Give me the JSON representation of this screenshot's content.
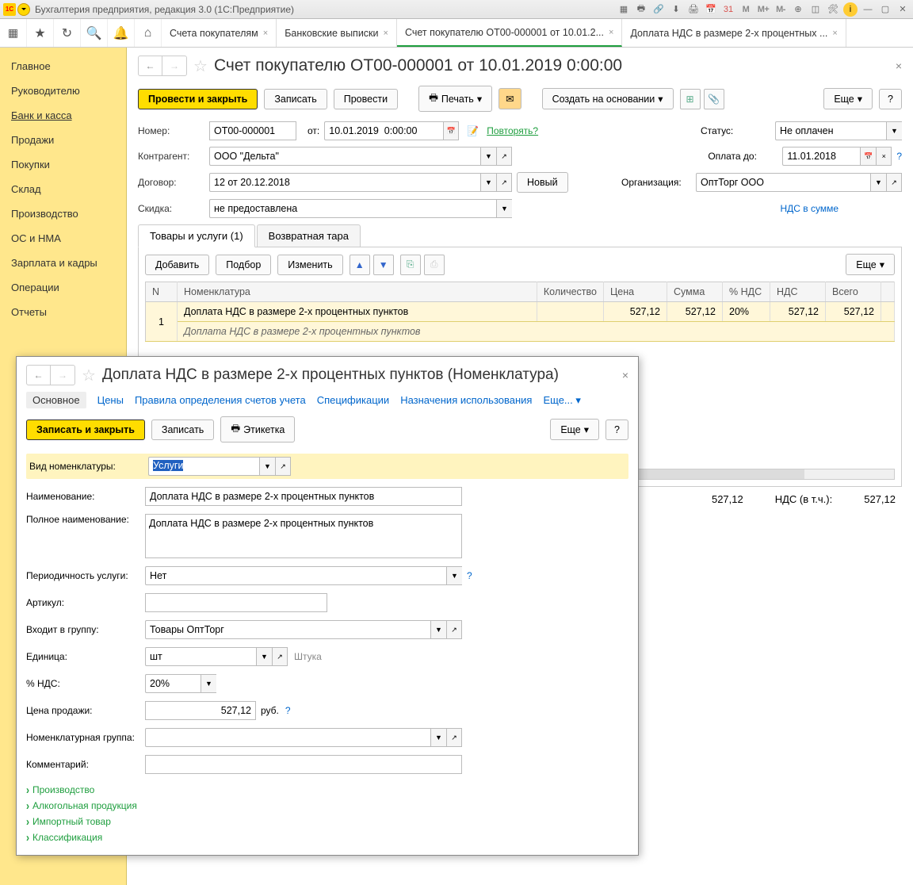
{
  "titlebar": {
    "title": "Бухгалтерия предприятия, редакция 3.0  (1С:Предприятие)"
  },
  "tabs": [
    {
      "label": "Счета покупателям",
      "active": false
    },
    {
      "label": "Банковские выписки",
      "active": false
    },
    {
      "label": "Счет покупателю ОТ00-000001 от 10.01.2...",
      "active": true
    },
    {
      "label": "Доплата НДС в размере 2-х процентных ...",
      "active": false
    }
  ],
  "sidebar": [
    "Главное",
    "Руководителю",
    "Банк и касса",
    "Продажи",
    "Покупки",
    "Склад",
    "Производство",
    "ОС и НМА",
    "Зарплата и кадры",
    "Операции",
    "Отчеты"
  ],
  "sidebar_active": "Банк и касса",
  "page": {
    "title": "Счет покупателю ОТ00-000001 от 10.01.2019 0:00:00",
    "buttons": {
      "commit_close": "Провести и закрыть",
      "write": "Записать",
      "commit": "Провести",
      "print": "Печать",
      "create_based": "Создать на основании",
      "more": "Еще"
    },
    "fields": {
      "number_label": "Номер:",
      "number": "ОТ00-000001",
      "date_label": "от:",
      "date": "10.01.2019  0:00:00",
      "repeat": "Повторять?",
      "status_label": "Статус:",
      "status": "Не оплачен",
      "counterparty_label": "Контрагент:",
      "counterparty": "ООО \"Дельта\"",
      "pay_until_label": "Оплата до:",
      "pay_until": "11.01.2018",
      "contract_label": "Договор:",
      "contract": "12 от 20.12.2018",
      "new_btn": "Новый",
      "org_label": "Организация:",
      "org": "ОптТорг ООО",
      "discount_label": "Скидка:",
      "discount": "не предоставлена",
      "nds_mode": "НДС в сумме"
    },
    "inner_tabs": [
      "Товары и услуги (1)",
      "Возвратная тара"
    ],
    "grid_toolbar": {
      "add": "Добавить",
      "pick": "Подбор",
      "edit": "Изменить",
      "more": "Еще"
    },
    "grid_headers": [
      "N",
      "Номенклатура",
      "Количество",
      "Цена",
      "Сумма",
      "% НДС",
      "НДС",
      "Всего"
    ],
    "grid_row": {
      "n": "1",
      "name": "Доплата НДС в размере 2-х процентных пунктов",
      "name2": "Доплата НДС в размере 2-х процентных пунктов",
      "qty": "",
      "price": "527,12",
      "sum": "527,12",
      "vat_pct": "20%",
      "vat": "527,12",
      "total": "527,12"
    },
    "totals": {
      "sum": "527,12",
      "vat_label": "НДС (в т.ч.):",
      "vat": "527,12"
    }
  },
  "dialog": {
    "title": "Доплата НДС в размере 2-х процентных пунктов (Номенклатура)",
    "tabs": [
      "Основное",
      "Цены",
      "Правила определения счетов учета",
      "Спецификации",
      "Назначения использования",
      "Еще..."
    ],
    "buttons": {
      "save_close": "Записать и закрыть",
      "save": "Записать",
      "label_btn": "Этикетка",
      "more": "Еще"
    },
    "fields": {
      "type_label": "Вид номенклатуры:",
      "type": "Услуги",
      "name_label": "Наименование:",
      "name": "Доплата НДС в размере 2-х процентных пунктов",
      "fullname_label": "Полное наименование:",
      "fullname": "Доплата НДС в размере 2-х процентных пунктов",
      "period_label": "Периодичность услуги:",
      "period": "Нет",
      "sku_label": "Артикул:",
      "sku": "",
      "group_label": "Входит в группу:",
      "group": "Товары ОптТорг",
      "unit_label": "Единица:",
      "unit": "шт",
      "unit_hint": "Штука",
      "vat_label": "% НДС:",
      "vat": "20%",
      "price_label": "Цена продажи:",
      "price": "527,12",
      "price_cur": "руб.",
      "nomgroup_label": "Номенклатурная группа:",
      "nomgroup": "",
      "comment_label": "Комментарий:",
      "comment": ""
    },
    "expands": [
      "Производство",
      "Алкогольная продукция",
      "Импортный товар",
      "Классификация"
    ]
  }
}
